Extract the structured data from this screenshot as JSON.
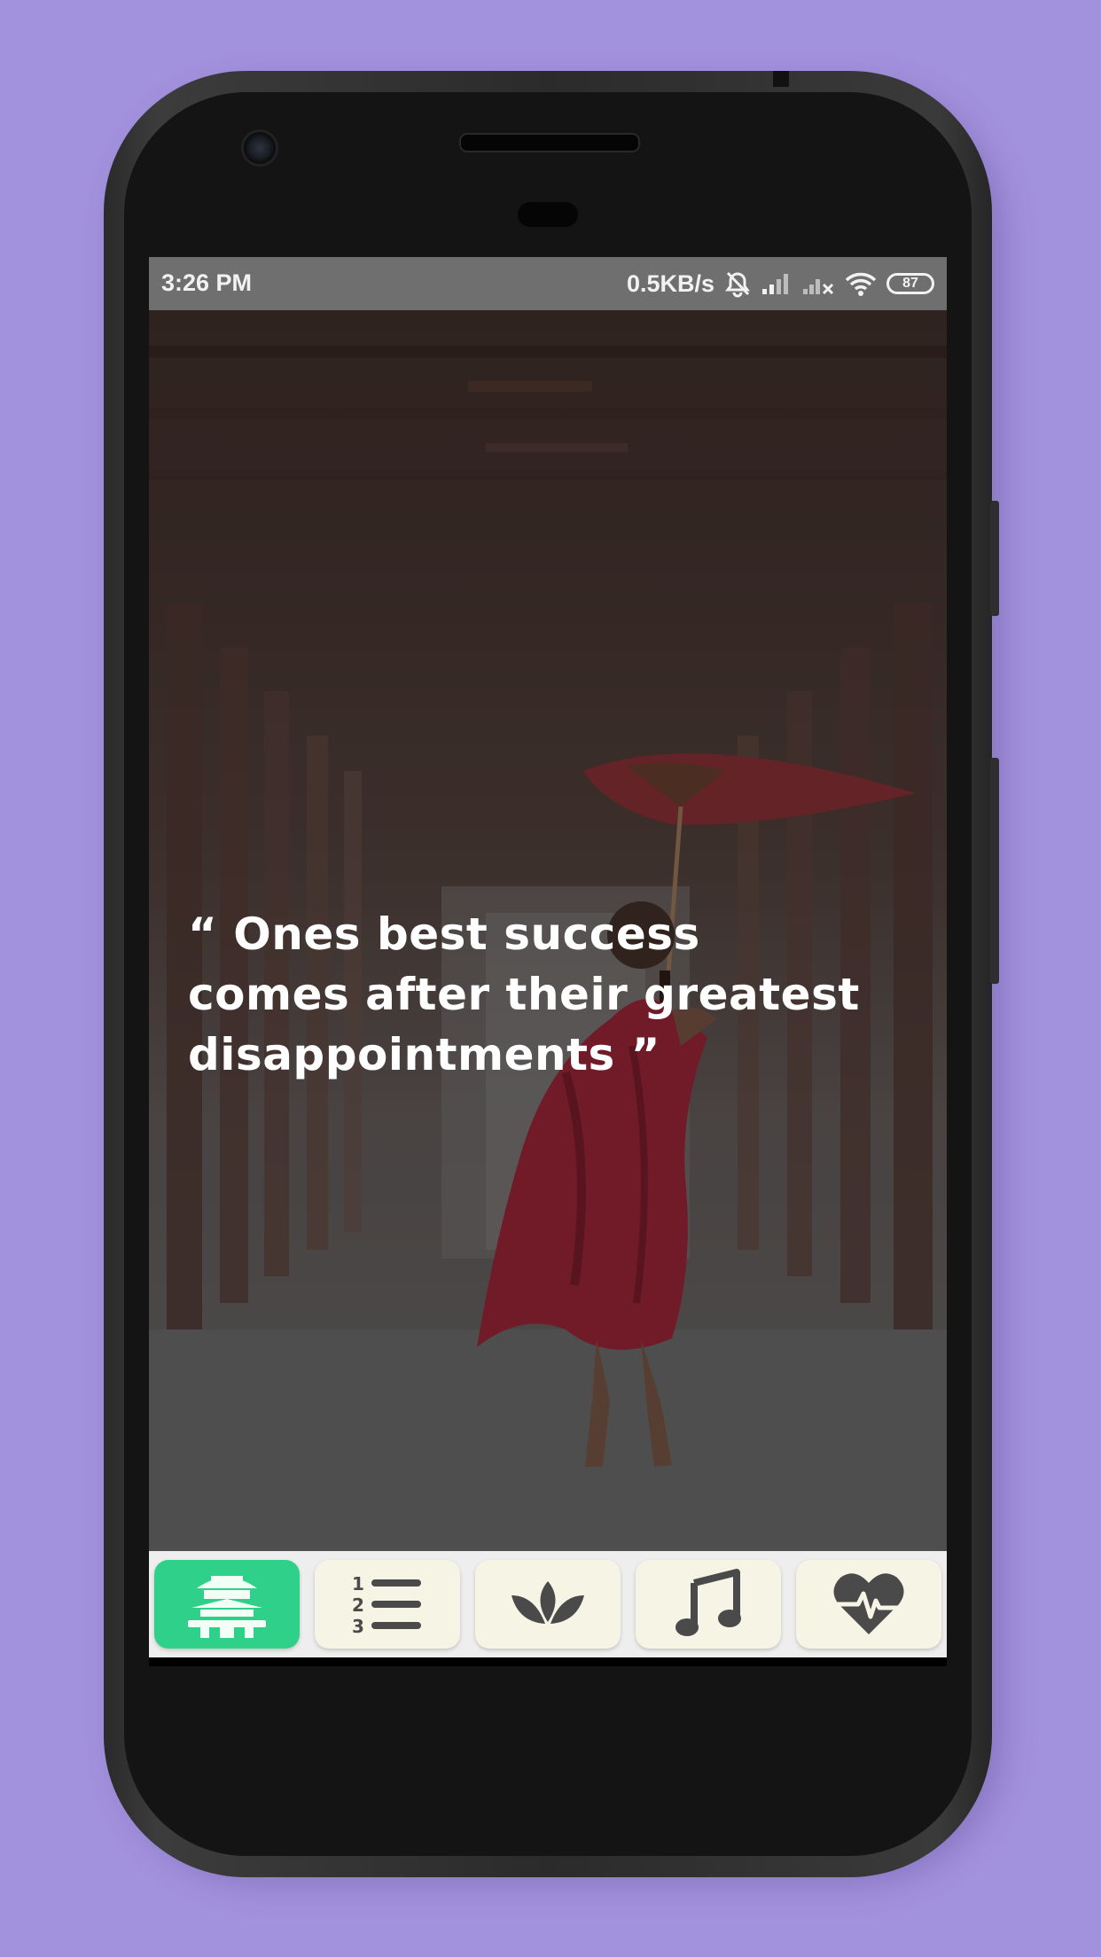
{
  "status_bar": {
    "time": "3:26 PM",
    "network_speed": "0.5KB/s",
    "battery_level": "87",
    "icons": [
      "alarm-off-icon",
      "signal-icon",
      "signal-no-sim-icon",
      "wifi-icon",
      "battery-icon"
    ]
  },
  "quote": {
    "text": "“ Ones best success\ncomes after their greatest\ndisappointments ”"
  },
  "bottom_nav": {
    "items": [
      {
        "icon": "temple-icon",
        "active": true
      },
      {
        "icon": "numbered-list-icon",
        "active": false
      },
      {
        "icon": "lotus-icon",
        "active": false
      },
      {
        "icon": "music-note-icon",
        "active": false
      },
      {
        "icon": "heartbeat-icon",
        "active": false
      }
    ]
  },
  "colors": {
    "background": "#a291dd",
    "active_tab": "#2fd089",
    "tab_background": "#f6f4e4",
    "icon_color": "#4a4a4a",
    "robe": "#8a2233"
  }
}
